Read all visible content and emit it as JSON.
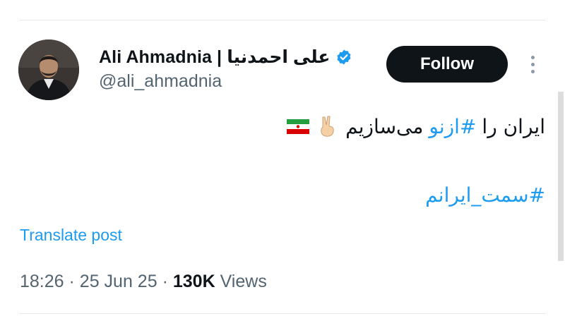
{
  "author": {
    "display_name": "Ali Ahmadnia | علی احمدنیا",
    "handle": "@ali_ahmadnia",
    "verified_icon": "verified-badge-icon",
    "accent_color": "#1d9bf0"
  },
  "actions": {
    "follow_label": "Follow",
    "more_icon": "more-vertical-icon"
  },
  "post": {
    "line1_before": "ایران را",
    "line1_hashtag": "#ازنو",
    "line1_after": "می‌سازیم",
    "emoji": [
      "victory-hand-icon",
      "iran-flag-icon"
    ],
    "line2_hashtag": "#سمت_ایرانم",
    "translate_label": "Translate post"
  },
  "meta": {
    "time": "18:26",
    "sep1": "·",
    "date": "25 Jun 25",
    "sep2": "·",
    "views_count": "130K",
    "views_label": "Views"
  }
}
